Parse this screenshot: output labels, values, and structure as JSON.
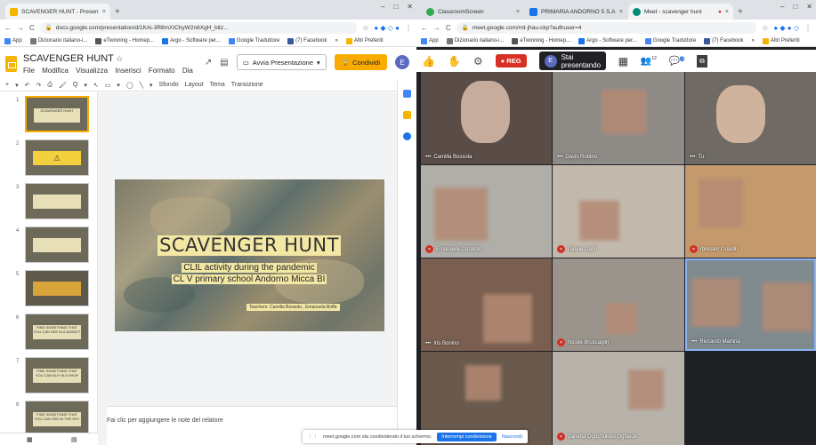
{
  "left": {
    "tabs": [
      {
        "title": "SCAVENGER HUNT - Presentaz...",
        "close": "×",
        "color": "#f4b400"
      }
    ],
    "new_tab": "+",
    "window_controls": [
      "–",
      "□",
      "✕"
    ],
    "url": "docs.google.com/presentation/d/1KAi-3R8mXIChyW2n6XgH_bitz...",
    "bookmarks": [
      {
        "label": "App",
        "color": "#4285f4"
      },
      {
        "label": "Dizionario italiano-i...",
        "color": "#777"
      },
      {
        "label": "eTwinning - Homep...",
        "color": "#555"
      },
      {
        "label": "Argo - Software per...",
        "color": "#1a73e8"
      },
      {
        "label": "Google Traduttore",
        "color": "#4285f4"
      },
      {
        "label": "(7) Facebook",
        "color": "#3b5998"
      },
      {
        "label": "»",
        "color": "#fff"
      },
      {
        "label": "Altri Preferiti",
        "color": "#f4b400"
      }
    ],
    "app": {
      "title": "SCAVENGER HUNT",
      "star": "☆",
      "menu": [
        "File",
        "Modifica",
        "Visualizza",
        "Inserisci",
        "Formato",
        "Dia"
      ],
      "present_label": "Avvia Presentazione",
      "share_label": "Condividi",
      "avatar": "E",
      "toolbar": [
        "+",
        "▾",
        "↶",
        "↷",
        "⎙",
        "🖌",
        "Q",
        "▾",
        "↖",
        "▭",
        "▾",
        "◯",
        "╲",
        "▾",
        "Sfondo",
        "Layout",
        "Tema",
        "Transizione",
        "^"
      ]
    },
    "slides": [
      {
        "num": "1",
        "text": "SCAVENGER HUNT"
      },
      {
        "num": "2",
        "text": "⚠"
      },
      {
        "num": "3",
        "text": ""
      },
      {
        "num": "4",
        "text": ""
      },
      {
        "num": "5",
        "text": ""
      },
      {
        "num": "6",
        "text": "FIND SOMETHING THAT YOU CAN SEE IN A BASKET"
      },
      {
        "num": "7",
        "text": "FIND SOMETHING THAT YOU CAN BUY IN A SHOP"
      },
      {
        "num": "8",
        "text": "FIND SOMETHING THAT YOU CAN SEE IN THE SKY"
      }
    ],
    "main_slide": {
      "title": "SCAVENGER HUNT",
      "subtitle1": "CLIL activity during the pandemic",
      "subtitle2": "CL V primary school Andorno Micca BI",
      "teachers": "Teachers: Camilla Bossola , Emanuela Boffa"
    },
    "notes_placeholder": "Fai clic per aggiungere le note del relatore"
  },
  "right": {
    "tabs": [
      {
        "title": "ClassroomScreen",
        "close": "×",
        "color": "#34a853"
      },
      {
        "title": "PRIMARIA ANDORNO 5 S.A.",
        "close": "×",
        "color": "#1a73e8"
      },
      {
        "title": "Meet - scavenger hunt",
        "close": "×",
        "color": "#00897b"
      }
    ],
    "new_tab": "+",
    "window_controls": [
      "–",
      "□",
      "✕"
    ],
    "url": "meet.google.com/rrd-jhau-ckp?authuser=4",
    "bookmarks": [
      {
        "label": "App",
        "color": "#4285f4"
      },
      {
        "label": "Dizionario italiano-i...",
        "color": "#777"
      },
      {
        "label": "eTwinning - Homep...",
        "color": "#555"
      },
      {
        "label": "Argo - Software per...",
        "color": "#1a73e8"
      },
      {
        "label": "Google Traduttore",
        "color": "#4285f4"
      },
      {
        "label": "(7) Facebook",
        "color": "#3b5998"
      },
      {
        "label": "»",
        "color": "#fff"
      },
      {
        "label": "Altri Preferiti",
        "color": "#f4b400"
      }
    ],
    "meet": {
      "rec_label": "REG",
      "presenting_label": "Stai presentando",
      "presenter_avatar": "E",
      "participants_count": "12",
      "chat_count": "2",
      "participants": [
        {
          "name": "Camilla Bossola",
          "muted": false,
          "bg": "#5a4d48"
        },
        {
          "name": "Davis Rubino",
          "muted": false,
          "bg": "#8e8a86"
        },
        {
          "name": "Tu",
          "muted": false,
          "bg": "#6f6a64"
        },
        {
          "name": "Emanuele Curatolo",
          "muted": true,
          "bg": "#b0aea8"
        },
        {
          "name": "Gioele Gallo",
          "muted": true,
          "bg": "#c2b9ad"
        },
        {
          "name": "Ibtesam Ouadih",
          "muted": true,
          "bg": "#c49a6c"
        },
        {
          "name": "Iris Bonino",
          "muted": false,
          "bg": "#7a5e4f"
        },
        {
          "name": "Nicole Bruscaglin",
          "muted": true,
          "bg": "#9a948c"
        },
        {
          "name": "Riccardo Martina",
          "muted": false,
          "bg": "#7f8a8f"
        },
        {
          "name": "",
          "muted": false,
          "bg": "#6a5a4d"
        },
        {
          "name": "Zanetta Ogochukwu Ogbeide",
          "muted": true,
          "bg": "#b7b3ab"
        },
        {
          "name": "",
          "muted": false,
          "bg": "#2c2c2c"
        }
      ]
    },
    "share_notice": {
      "text": "meet.google.com sta condividendo il tuo schermo.",
      "stop": "Interrompi condivisione",
      "hide": "Nascondi"
    }
  }
}
